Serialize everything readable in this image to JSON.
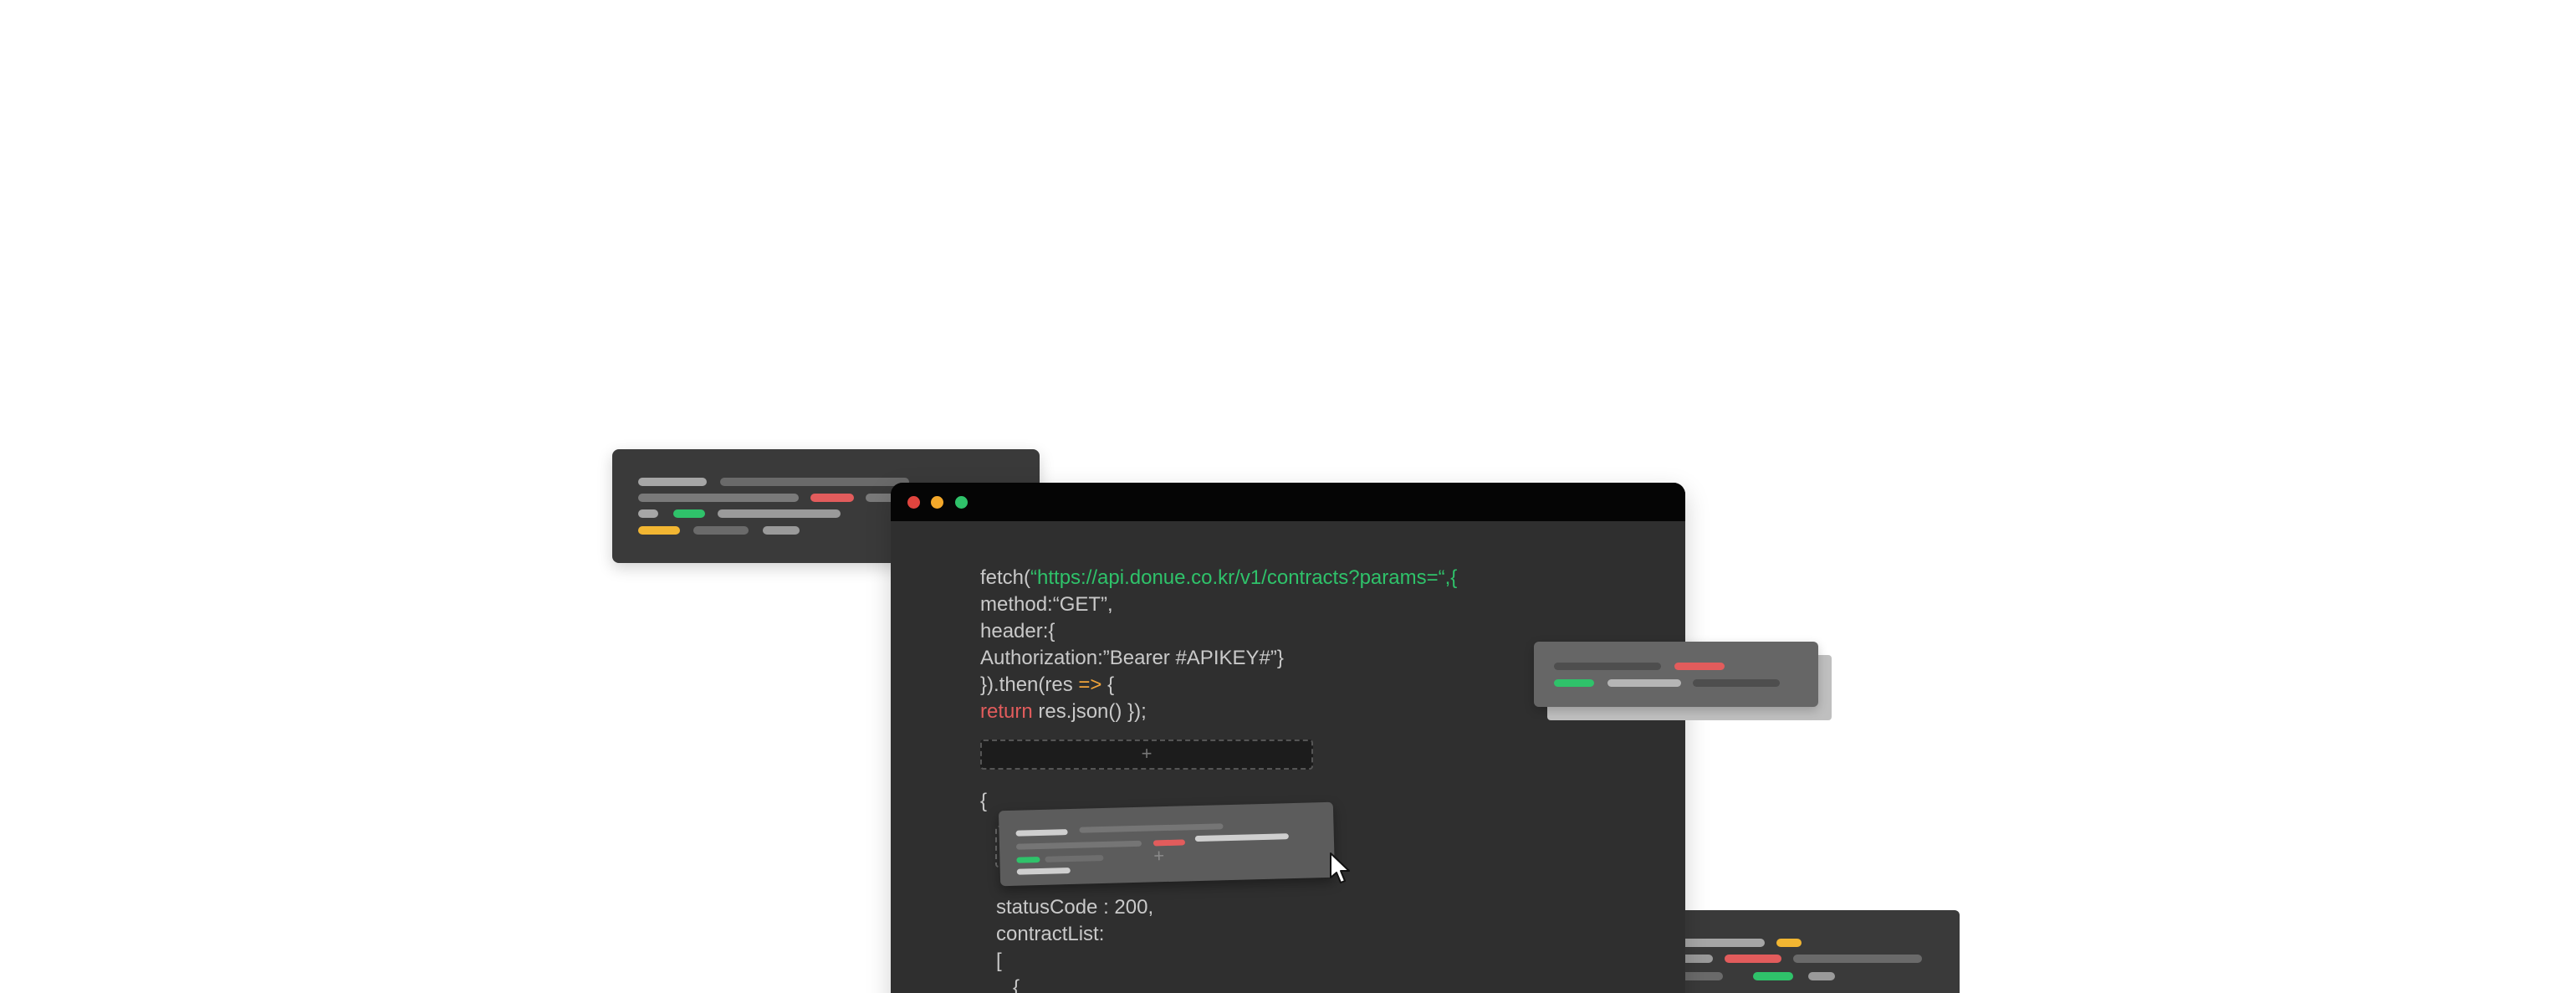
{
  "window": {
    "traffic_lights": {
      "close_color": "#e0443e",
      "minimize_color": "#f4a82a",
      "maximize_color": "#2fc26a"
    }
  },
  "code_request": {
    "line1_fn": "fetch(",
    "line1_url": "“https://api.donue.co.kr/v1/contracts?params=“,{",
    "line2": "method:“GET”,",
    "line3": "header:{",
    "line4": "Authorization:”Bearer #APIKEY#”}",
    "line5_a": "}).then(res ",
    "line5_arrow": "=>",
    "line5_b": " {",
    "line6_kw": "return",
    "line6_rest": " res.json() });"
  },
  "drop_zone": {
    "plus": "+"
  },
  "drag_card": {
    "plus": "+"
  },
  "code_response": {
    "open_brace": "{",
    "status_line": "statusCode : 200,",
    "list_line": "contractList:",
    "bracket": "[",
    "inner_brace": "{"
  },
  "icons": {
    "cursor": "mouse-pointer-icon"
  },
  "colors": {
    "bar_light": "#9a9a9a",
    "bar_dark": "#5a5a5a",
    "accent_red": "#e25c5c",
    "accent_green": "#2fc26a",
    "accent_yellow": "#f2b632"
  }
}
